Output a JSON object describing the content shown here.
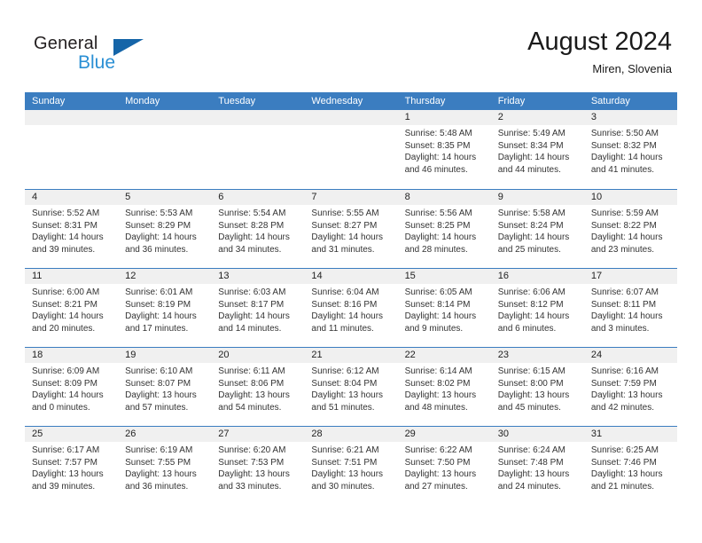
{
  "brand": {
    "name_part1": "General",
    "name_part2": "Blue",
    "accent_color": "#2a8fd4",
    "triangle_color": "#1565a8"
  },
  "header": {
    "title": "August 2024",
    "subtitle": "Miren, Slovenia"
  },
  "theme": {
    "header_row_bg": "#3b7dc0",
    "day_number_bg": "#f0f0f0",
    "text_color": "#333333"
  },
  "weekdays": [
    "Sunday",
    "Monday",
    "Tuesday",
    "Wednesday",
    "Thursday",
    "Friday",
    "Saturday"
  ],
  "weeks": [
    [
      {
        "day": "",
        "sunrise": "",
        "sunset": "",
        "daylight": ""
      },
      {
        "day": "",
        "sunrise": "",
        "sunset": "",
        "daylight": ""
      },
      {
        "day": "",
        "sunrise": "",
        "sunset": "",
        "daylight": ""
      },
      {
        "day": "",
        "sunrise": "",
        "sunset": "",
        "daylight": ""
      },
      {
        "day": "1",
        "sunrise": "Sunrise: 5:48 AM",
        "sunset": "Sunset: 8:35 PM",
        "daylight": "Daylight: 14 hours and 46 minutes."
      },
      {
        "day": "2",
        "sunrise": "Sunrise: 5:49 AM",
        "sunset": "Sunset: 8:34 PM",
        "daylight": "Daylight: 14 hours and 44 minutes."
      },
      {
        "day": "3",
        "sunrise": "Sunrise: 5:50 AM",
        "sunset": "Sunset: 8:32 PM",
        "daylight": "Daylight: 14 hours and 41 minutes."
      }
    ],
    [
      {
        "day": "4",
        "sunrise": "Sunrise: 5:52 AM",
        "sunset": "Sunset: 8:31 PM",
        "daylight": "Daylight: 14 hours and 39 minutes."
      },
      {
        "day": "5",
        "sunrise": "Sunrise: 5:53 AM",
        "sunset": "Sunset: 8:29 PM",
        "daylight": "Daylight: 14 hours and 36 minutes."
      },
      {
        "day": "6",
        "sunrise": "Sunrise: 5:54 AM",
        "sunset": "Sunset: 8:28 PM",
        "daylight": "Daylight: 14 hours and 34 minutes."
      },
      {
        "day": "7",
        "sunrise": "Sunrise: 5:55 AM",
        "sunset": "Sunset: 8:27 PM",
        "daylight": "Daylight: 14 hours and 31 minutes."
      },
      {
        "day": "8",
        "sunrise": "Sunrise: 5:56 AM",
        "sunset": "Sunset: 8:25 PM",
        "daylight": "Daylight: 14 hours and 28 minutes."
      },
      {
        "day": "9",
        "sunrise": "Sunrise: 5:58 AM",
        "sunset": "Sunset: 8:24 PM",
        "daylight": "Daylight: 14 hours and 25 minutes."
      },
      {
        "day": "10",
        "sunrise": "Sunrise: 5:59 AM",
        "sunset": "Sunset: 8:22 PM",
        "daylight": "Daylight: 14 hours and 23 minutes."
      }
    ],
    [
      {
        "day": "11",
        "sunrise": "Sunrise: 6:00 AM",
        "sunset": "Sunset: 8:21 PM",
        "daylight": "Daylight: 14 hours and 20 minutes."
      },
      {
        "day": "12",
        "sunrise": "Sunrise: 6:01 AM",
        "sunset": "Sunset: 8:19 PM",
        "daylight": "Daylight: 14 hours and 17 minutes."
      },
      {
        "day": "13",
        "sunrise": "Sunrise: 6:03 AM",
        "sunset": "Sunset: 8:17 PM",
        "daylight": "Daylight: 14 hours and 14 minutes."
      },
      {
        "day": "14",
        "sunrise": "Sunrise: 6:04 AM",
        "sunset": "Sunset: 8:16 PM",
        "daylight": "Daylight: 14 hours and 11 minutes."
      },
      {
        "day": "15",
        "sunrise": "Sunrise: 6:05 AM",
        "sunset": "Sunset: 8:14 PM",
        "daylight": "Daylight: 14 hours and 9 minutes."
      },
      {
        "day": "16",
        "sunrise": "Sunrise: 6:06 AM",
        "sunset": "Sunset: 8:12 PM",
        "daylight": "Daylight: 14 hours and 6 minutes."
      },
      {
        "day": "17",
        "sunrise": "Sunrise: 6:07 AM",
        "sunset": "Sunset: 8:11 PM",
        "daylight": "Daylight: 14 hours and 3 minutes."
      }
    ],
    [
      {
        "day": "18",
        "sunrise": "Sunrise: 6:09 AM",
        "sunset": "Sunset: 8:09 PM",
        "daylight": "Daylight: 14 hours and 0 minutes."
      },
      {
        "day": "19",
        "sunrise": "Sunrise: 6:10 AM",
        "sunset": "Sunset: 8:07 PM",
        "daylight": "Daylight: 13 hours and 57 minutes."
      },
      {
        "day": "20",
        "sunrise": "Sunrise: 6:11 AM",
        "sunset": "Sunset: 8:06 PM",
        "daylight": "Daylight: 13 hours and 54 minutes."
      },
      {
        "day": "21",
        "sunrise": "Sunrise: 6:12 AM",
        "sunset": "Sunset: 8:04 PM",
        "daylight": "Daylight: 13 hours and 51 minutes."
      },
      {
        "day": "22",
        "sunrise": "Sunrise: 6:14 AM",
        "sunset": "Sunset: 8:02 PM",
        "daylight": "Daylight: 13 hours and 48 minutes."
      },
      {
        "day": "23",
        "sunrise": "Sunrise: 6:15 AM",
        "sunset": "Sunset: 8:00 PM",
        "daylight": "Daylight: 13 hours and 45 minutes."
      },
      {
        "day": "24",
        "sunrise": "Sunrise: 6:16 AM",
        "sunset": "Sunset: 7:59 PM",
        "daylight": "Daylight: 13 hours and 42 minutes."
      }
    ],
    [
      {
        "day": "25",
        "sunrise": "Sunrise: 6:17 AM",
        "sunset": "Sunset: 7:57 PM",
        "daylight": "Daylight: 13 hours and 39 minutes."
      },
      {
        "day": "26",
        "sunrise": "Sunrise: 6:19 AM",
        "sunset": "Sunset: 7:55 PM",
        "daylight": "Daylight: 13 hours and 36 minutes."
      },
      {
        "day": "27",
        "sunrise": "Sunrise: 6:20 AM",
        "sunset": "Sunset: 7:53 PM",
        "daylight": "Daylight: 13 hours and 33 minutes."
      },
      {
        "day": "28",
        "sunrise": "Sunrise: 6:21 AM",
        "sunset": "Sunset: 7:51 PM",
        "daylight": "Daylight: 13 hours and 30 minutes."
      },
      {
        "day": "29",
        "sunrise": "Sunrise: 6:22 AM",
        "sunset": "Sunset: 7:50 PM",
        "daylight": "Daylight: 13 hours and 27 minutes."
      },
      {
        "day": "30",
        "sunrise": "Sunrise: 6:24 AM",
        "sunset": "Sunset: 7:48 PM",
        "daylight": "Daylight: 13 hours and 24 minutes."
      },
      {
        "day": "31",
        "sunrise": "Sunrise: 6:25 AM",
        "sunset": "Sunset: 7:46 PM",
        "daylight": "Daylight: 13 hours and 21 minutes."
      }
    ]
  ]
}
